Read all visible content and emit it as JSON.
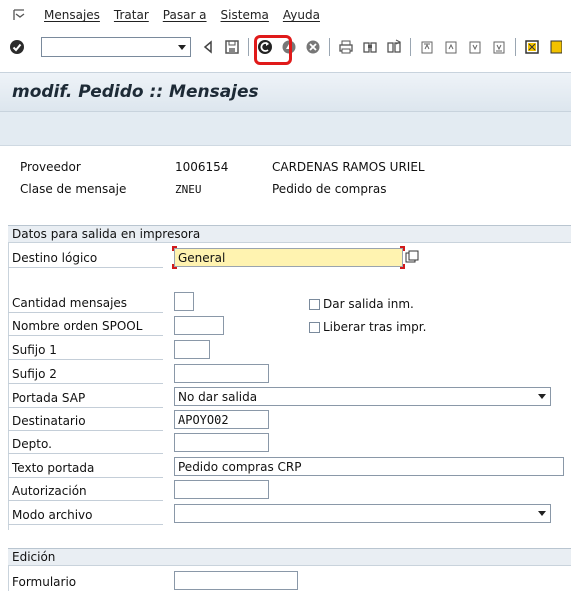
{
  "menu": {
    "items": [
      "Mensajes",
      "Tratar",
      "Pasar a",
      "Sistema",
      "Ayuda"
    ]
  },
  "toolbar": {
    "command_value": "",
    "icons": [
      "enter-icon",
      "dropdown-icon",
      "back-arrow-icon",
      "save-icon",
      "back-icon",
      "exit-icon",
      "cancel-icon",
      "print-icon",
      "find-icon",
      "find-next-icon",
      "first-page-icon",
      "previous-page-icon",
      "next-page-icon",
      "last-page-icon",
      "new-session-icon",
      "shortcut-icon"
    ],
    "highlight_color": "#e01a1a"
  },
  "title": "modif. Pedido :: Mensajes",
  "header": {
    "proveedor_label": "Proveedor",
    "proveedor_code": "1006154",
    "proveedor_name": "CARDENAS RAMOS URIEL",
    "clase_label": "Clase de mensaje",
    "clase_code": "ZNEU",
    "clase_desc": "Pedido de compras"
  },
  "print_section": {
    "title": "Datos para salida en impresora",
    "destino_label": "Destino lógico",
    "destino_value": "General",
    "cantidad_label": "Cantidad mensajes",
    "cantidad_value": "",
    "dar_salida_label": "Dar salida inm.",
    "nombre_spool_label": "Nombre orden SPOOL",
    "nombre_spool_value": "",
    "liberar_label": "Liberar tras impr.",
    "sufijo1_label": "Sufijo 1",
    "sufijo1_value": "",
    "sufijo2_label": "Sufijo 2",
    "sufijo2_value": "",
    "portada_label": "Portada SAP",
    "portada_value": "No dar salida",
    "destinatario_label": "Destinatario",
    "destinatario_value": "APOYO02",
    "depto_label": "Depto.",
    "depto_value": "",
    "texto_portada_label": "Texto portada",
    "texto_portada_value": "Pedido compras CRP",
    "autorizacion_label": "Autorización",
    "autorizacion_value": "",
    "modo_archivo_label": "Modo archivo",
    "modo_archivo_value": ""
  },
  "edicion_section": {
    "title": "Edición",
    "formulario_label": "Formulario",
    "formulario_value": ""
  },
  "colors": {
    "title_bg": "#e3ebf2",
    "focus_bg": "#fff3b0",
    "focus_corner": "#d21a1a"
  }
}
